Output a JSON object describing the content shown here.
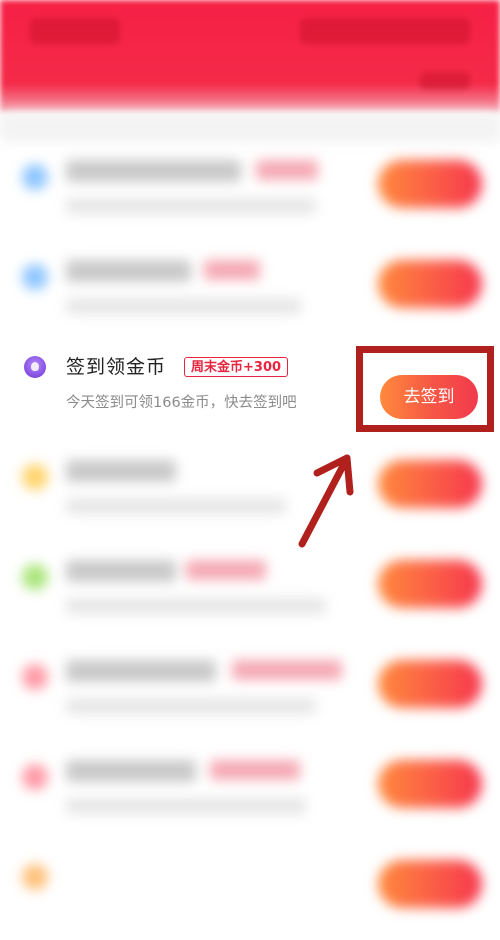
{
  "task_item": {
    "icon": "checkin-badge-icon",
    "title": "签到领金币",
    "tag": "周末金币+300",
    "description": "今天签到可领166金币，快去签到吧",
    "button_label": "去签到"
  },
  "colors": {
    "header_red": "#f42a48",
    "tag_red": "#e8243f",
    "button_gradient_start": "#ff8a3d",
    "button_gradient_end": "#f23a4d",
    "annotation_red": "#b0201c",
    "icon_purple": "#8a55e6"
  },
  "annotation": {
    "highlight_target": "去签到",
    "arrow_icon": "pointer-arrow-icon"
  }
}
